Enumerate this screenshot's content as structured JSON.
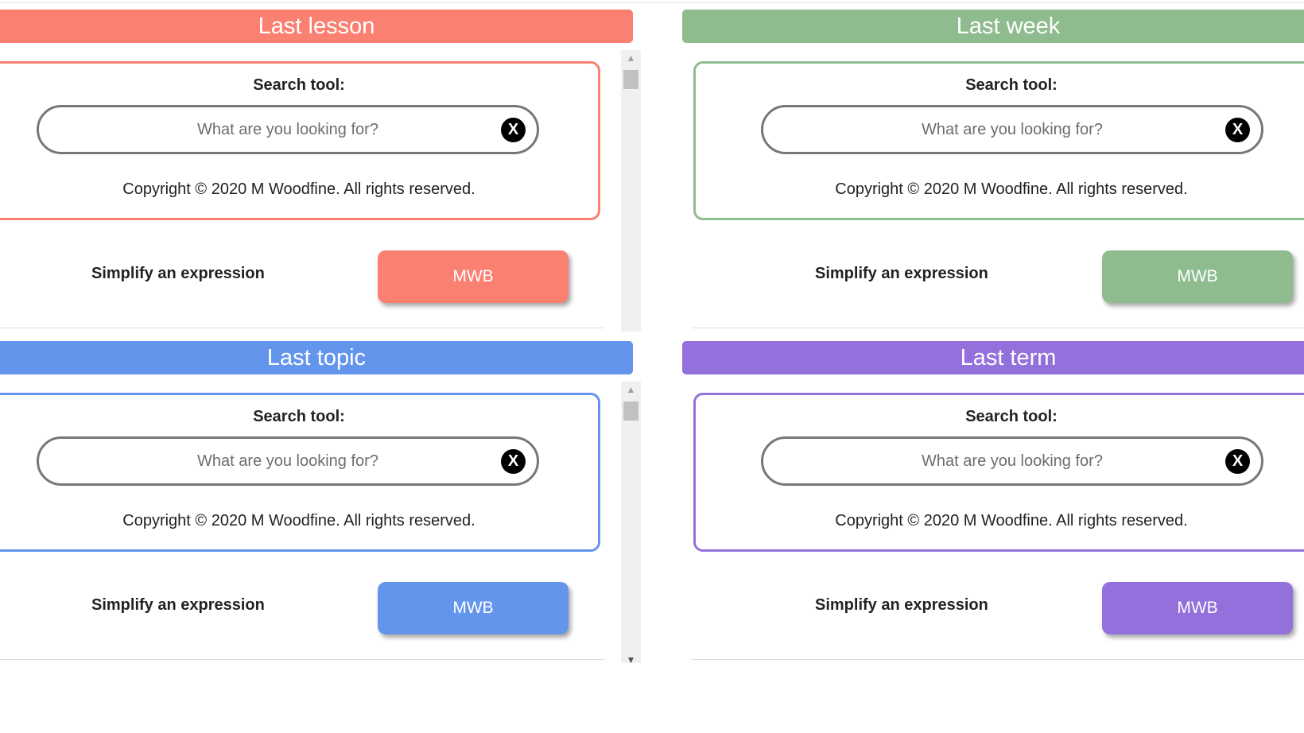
{
  "sections": [
    {
      "title": "Last lesson",
      "color": "#fa8072",
      "search_title": "Search tool:",
      "search_placeholder": "What are you looking for?",
      "clear_label": "X",
      "copyright": "Copyright © 2020 M Woodfine. All rights reserved.",
      "row_label": "Simplify an expression",
      "button_label": "MWB"
    },
    {
      "title": "Last week",
      "color": "#8fbc8f",
      "search_title": "Search tool:",
      "search_placeholder": "What are you looking for?",
      "clear_label": "X",
      "copyright": "Copyright © 2020 M Woodfine. All rights reserved.",
      "row_label": "Simplify an expression",
      "button_label": "MWB"
    },
    {
      "title": "Last topic",
      "color": "#6495ed",
      "search_title": "Search tool:",
      "search_placeholder": "What are you looking for?",
      "clear_label": "X",
      "copyright": "Copyright © 2020 M Woodfine. All rights reserved.",
      "row_label": "Simplify an expression",
      "button_label": "MWB"
    },
    {
      "title": "Last term",
      "color": "#9370db",
      "search_title": "Search tool:",
      "search_placeholder": "What are you looking for?",
      "clear_label": "X",
      "copyright": "Copyright © 2020 M Woodfine. All rights reserved.",
      "row_label": "Simplify an expression",
      "button_label": "MWB"
    }
  ],
  "scrollbar": {
    "up_icon": "triangle-up",
    "down_icon": "triangle-down"
  }
}
